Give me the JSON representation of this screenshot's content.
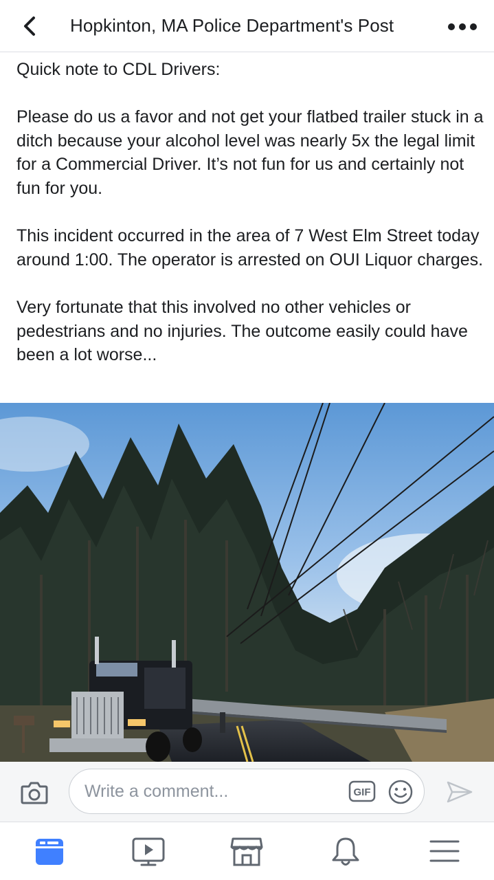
{
  "header": {
    "title": "Hopkinton, MA Police Department's Post",
    "back_icon": "chevron-left-icon",
    "more_icon": "more-horizontal-icon"
  },
  "post": {
    "intro": "Quick note to CDL Drivers:",
    "paragraph_1": "Please do us a favor and not get your flatbed trailer stuck in a ditch because your alcohol level was nearly 5x the legal limit for a Commercial Driver. It’s not fun for us and certainly not fun for you.",
    "paragraph_2": "This incident occurred in the area of 7 West Elm Street today around 1:00. The operator is arrested on OUI Liquor charges.",
    "paragraph_3": "Very fortunate that this involved no other vehicles or pedestrians and no injuries. The outcome easily could have been a lot worse..."
  },
  "photo": {
    "subject": "semi-truck with flatbed trailer in ditch on tree-lined road"
  },
  "comment_bar": {
    "placeholder": "Write a comment...",
    "gif_label": "GIF",
    "camera_icon": "camera-icon",
    "emoji_icon": "smiley-icon",
    "send_icon": "send-icon"
  },
  "bottom_nav": {
    "items": [
      {
        "icon": "news-feed-icon",
        "active": true
      },
      {
        "icon": "watch-video-icon",
        "active": false
      },
      {
        "icon": "marketplace-icon",
        "active": false
      },
      {
        "icon": "notifications-bell-icon",
        "active": false
      },
      {
        "icon": "menu-icon",
        "active": false
      }
    ]
  },
  "colors": {
    "accent": "#4080ff",
    "icon_gray": "#606770",
    "placeholder": "#8d949e",
    "bar_bg": "#f5f6f7"
  }
}
